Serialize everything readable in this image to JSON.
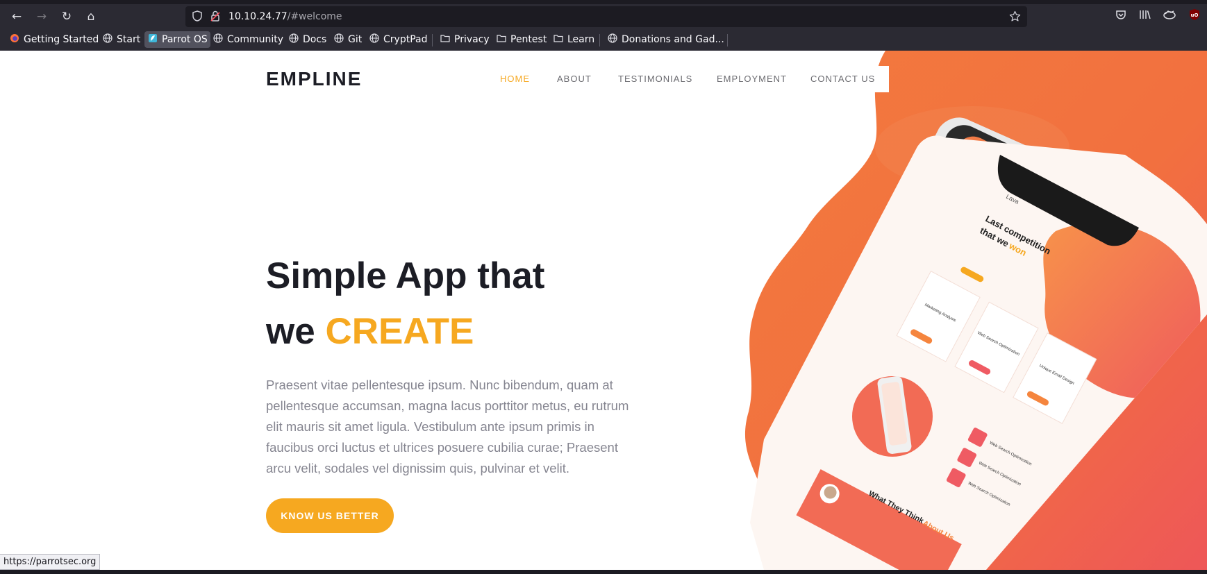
{
  "browser": {
    "url_host": "10.10.24.77",
    "url_path": "/#welcome",
    "nav": {
      "back": "←",
      "forward": "→",
      "reload": "↻",
      "home": "⌂"
    },
    "bookmarks": [
      {
        "label": "Getting Started",
        "icon": "firefox-icon"
      },
      {
        "label": "Start",
        "icon": "globe-icon"
      },
      {
        "label": "Parrot OS",
        "icon": "parrot-icon"
      },
      {
        "label": "Community",
        "icon": "globe-icon"
      },
      {
        "label": "Docs",
        "icon": "globe-icon"
      },
      {
        "label": "Git",
        "icon": "globe-icon"
      },
      {
        "label": "CryptPad",
        "icon": "globe-icon"
      },
      {
        "label": "Privacy",
        "icon": "folder-icon"
      },
      {
        "label": "Pentest",
        "icon": "folder-icon"
      },
      {
        "label": "Learn",
        "icon": "folder-icon"
      },
      {
        "label": "Donations and Gad...",
        "icon": "globe-icon"
      }
    ],
    "status_text": "https://parrotsec.org"
  },
  "site": {
    "logo": "EMPLINE",
    "menu": [
      "HOME",
      "ABOUT",
      "TESTIMONIALS",
      "EMPLOYMENT",
      "CONTACT US"
    ],
    "headline_line1": "Simple App that",
    "headline_we": "we",
    "headline_accent": "CREATE",
    "paragraph": "Praesent vitae pellentesque ipsum. Nunc bibendum, quam at pellentesque accumsan, magna lacus porttitor metus, eu rutrum elit mauris sit amet ligula. Vestibulum ante ipsum primis in faucibus orci luctus et ultrices posuere cubilia curae; Praesent arcu velit, sodales vel dignissim quis, pulvinar et velit.",
    "cta": "KNOW US BETTER"
  },
  "phone": {
    "top_label": "Lava",
    "heading_1": "Last competition",
    "heading_2": "that we",
    "heading_accent": "won",
    "card_1": "Marketing Analysis",
    "card_2": "Web Search Optimization",
    "card_3": "Unique Email Design",
    "feature_1": "Web Search Optimization",
    "feature_2": "Web Search Optimization",
    "feature_3": "Web Search Optimization",
    "testimonial_1": "What They Think",
    "testimonial_accent": "About Us"
  },
  "colors": {
    "accent": "#f6a820",
    "dark": "#1c1d25",
    "hero_orange": "#f0733e",
    "hero_red": "#ee5a5a"
  }
}
